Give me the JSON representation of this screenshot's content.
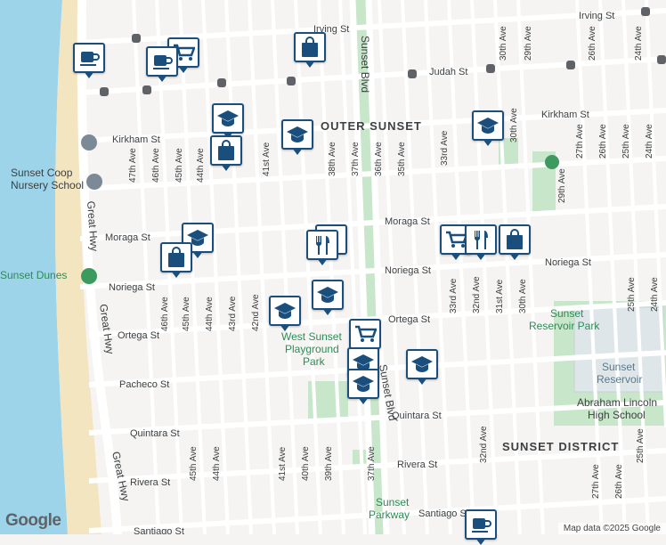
{
  "map": {
    "attribution": "Map data ©2025 Google",
    "logo": "Google",
    "area_labels": [
      "OUTER SUNSET",
      "SUNSET DISTRICT"
    ],
    "horizontal_streets": [
      {
        "name": "Irving St"
      },
      {
        "name": "Judah St"
      },
      {
        "name": "Kirkham St"
      },
      {
        "name": "Moraga St"
      },
      {
        "name": "Noriega St"
      },
      {
        "name": "Ortega St"
      },
      {
        "name": "Pacheco St"
      },
      {
        "name": "Quintara St"
      },
      {
        "name": "Rivera St"
      },
      {
        "name": "Santiago St"
      }
    ],
    "vertical_streets": [
      "47th Ave",
      "46th Ave",
      "45th Ave",
      "44th Ave",
      "43rd Ave",
      "42nd Ave",
      "41st Ave",
      "40th Ave",
      "39th Ave",
      "38th Ave",
      "37th Ave",
      "36th Ave",
      "35th Ave",
      "33rd Ave",
      "32nd Ave",
      "31st Ave",
      "30th Ave",
      "29th Ave",
      "27th Ave",
      "26th Ave",
      "25th Ave",
      "24th Ave"
    ],
    "major_roads": [
      "Sunset Blvd",
      "Great Hwy"
    ],
    "pois": [
      {
        "name": "Sunset Coop Nursery School",
        "line1": "Sunset Coop",
        "line2": "Nursery School"
      },
      {
        "name": "Sunset Dunes"
      },
      {
        "name": "West Sunset Playground Park",
        "line1": "West Sunset",
        "line2": "Playground",
        "line3": "Park"
      },
      {
        "name": "Sunset Reservoir Park",
        "line1": "Sunset",
        "line2": "Reservoir Park"
      },
      {
        "name": "Sunset Reservoir",
        "line1": "Sunset",
        "line2": "Reservoir"
      },
      {
        "name": "Abraham Lincoln High School",
        "line1": "Abraham Lincoln",
        "line2": "High School"
      },
      {
        "name": "Sunset Parkway",
        "line1": "Sunset",
        "line2": "Parkway"
      }
    ],
    "marker_icons": [
      "coffee-icon",
      "shopping-cart-icon",
      "coffee-icon",
      "shopping-bag-icon",
      "school-icon",
      "shopping-bag-icon",
      "school-icon",
      "school-icon",
      "restaurant-icon",
      "school-icon",
      "shopping-bag-icon",
      "restaurant-icon",
      "school-icon",
      "school-icon",
      "shopping-cart-icon",
      "school-icon",
      "school-icon",
      "school-icon",
      "shopping-cart-icon",
      "restaurant-icon",
      "shopping-bag-icon",
      "coffee-icon"
    ],
    "colors": {
      "marker": "#1a4e7c",
      "water": "#9dd4e9",
      "park": "#c8e6c9",
      "beach": "#f3e5c0",
      "road": "#ffffff"
    }
  }
}
